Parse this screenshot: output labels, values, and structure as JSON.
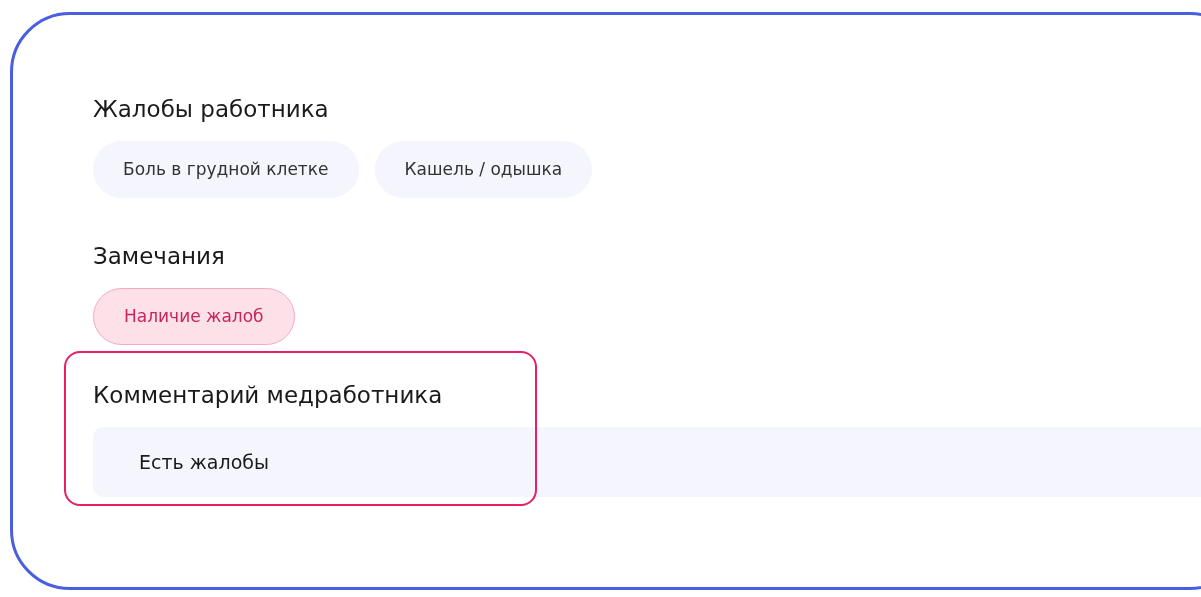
{
  "sections": [
    {
      "kind": "tags",
      "title": "Жалобы работника",
      "tags": [
        {
          "label": "Боль в грудной клетке",
          "alert": false
        },
        {
          "label": "Кашель / одышка",
          "alert": false
        }
      ]
    },
    {
      "kind": "tags",
      "title": "Замечания",
      "tags": [
        {
          "label": "Наличие жалоб",
          "alert": true
        }
      ]
    },
    {
      "kind": "field",
      "title": "Комментарий медработника",
      "value": "Есть жалобы",
      "highlighted": true
    }
  ]
}
